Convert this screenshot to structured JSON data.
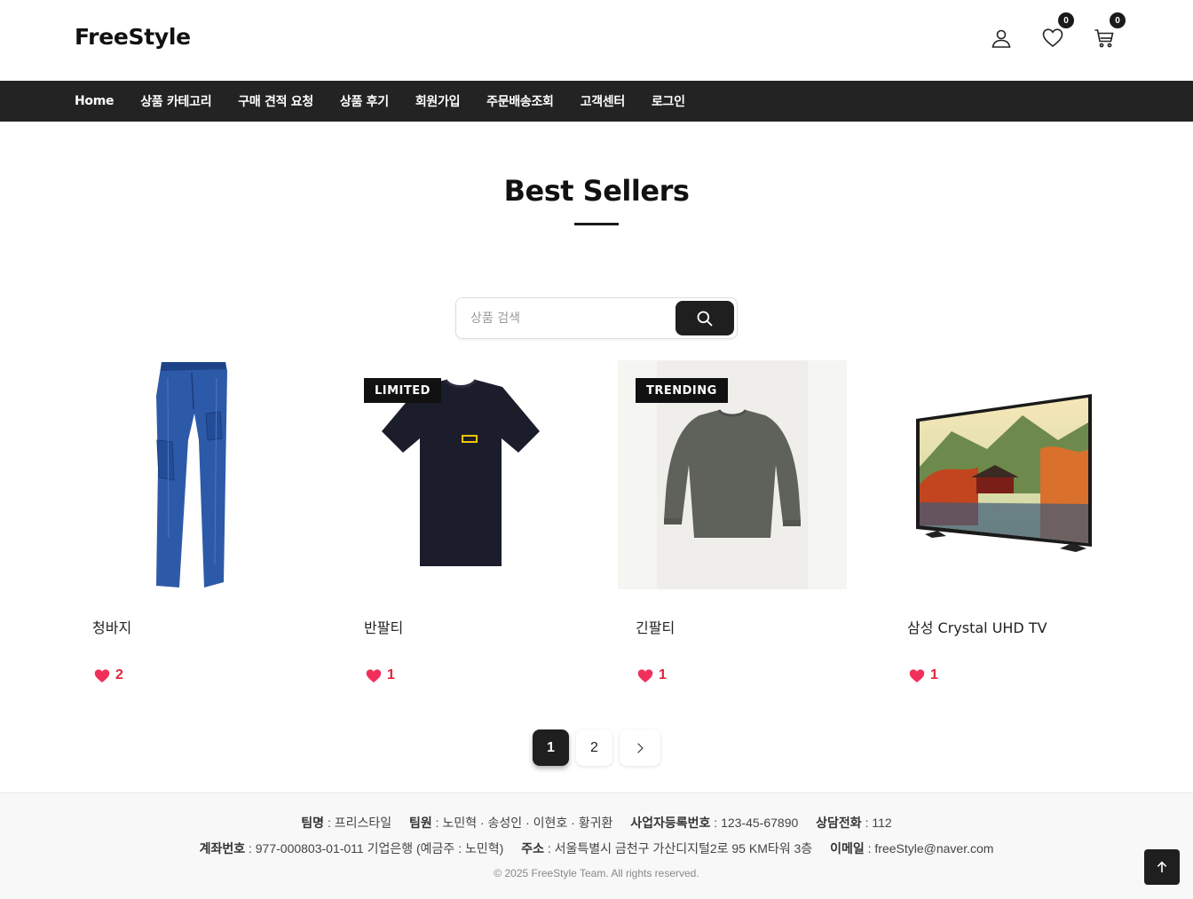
{
  "header": {
    "logo": "FreeStyle",
    "wishlist_count": "0",
    "cart_count": "0"
  },
  "nav": {
    "items": [
      "Home",
      "상품 카테고리",
      "구매 견적 요청",
      "상품 후기",
      "회원가입",
      "주문배송조회",
      "고객센터",
      "로그인"
    ]
  },
  "section": {
    "title": "Best Sellers"
  },
  "search": {
    "placeholder": "상품 검색"
  },
  "products": [
    {
      "name": "청바지",
      "tag": "",
      "likes": "2",
      "image_icon": "jeans-image"
    },
    {
      "name": "반팔티",
      "tag": "LIMITED",
      "likes": "1",
      "image_icon": "tshirt-image"
    },
    {
      "name": "긴팔티",
      "tag": "TRENDING",
      "likes": "1",
      "image_icon": "longsleeve-image"
    },
    {
      "name": "삼성 Crystal UHD TV",
      "tag": "",
      "likes": "1",
      "image_icon": "tv-image"
    }
  ],
  "pagination": {
    "pages": [
      "1",
      "2"
    ],
    "current": "1"
  },
  "footer": {
    "team_label": "팀명",
    "team_value": " : 프리스타일",
    "members_label": "팀원",
    "members_value": " : 노민혁 · 송성인 · 이현호 · 황귀환",
    "biz_label": "사업자등록번호",
    "biz_value": " : 123-45-67890",
    "phone_label": "상담전화",
    "phone_value": " : 112",
    "account_label": "계좌번호",
    "account_value": " : 977-000803-01-011 기업은행 (예금주 : 노민혁)",
    "address_label": "주소",
    "address_value": " : 서울특별시 금천구 가산디지털2로 95 KM타워 3층",
    "email_label": "이메일",
    "email_value": " : freeStyle@naver.com",
    "copyright": "© 2025 FreeStyle Team. All rights reserved."
  },
  "colors": {
    "nav_bg": "#232323",
    "accent_dark": "#1f1f1f",
    "like_red": "#e2243b"
  }
}
